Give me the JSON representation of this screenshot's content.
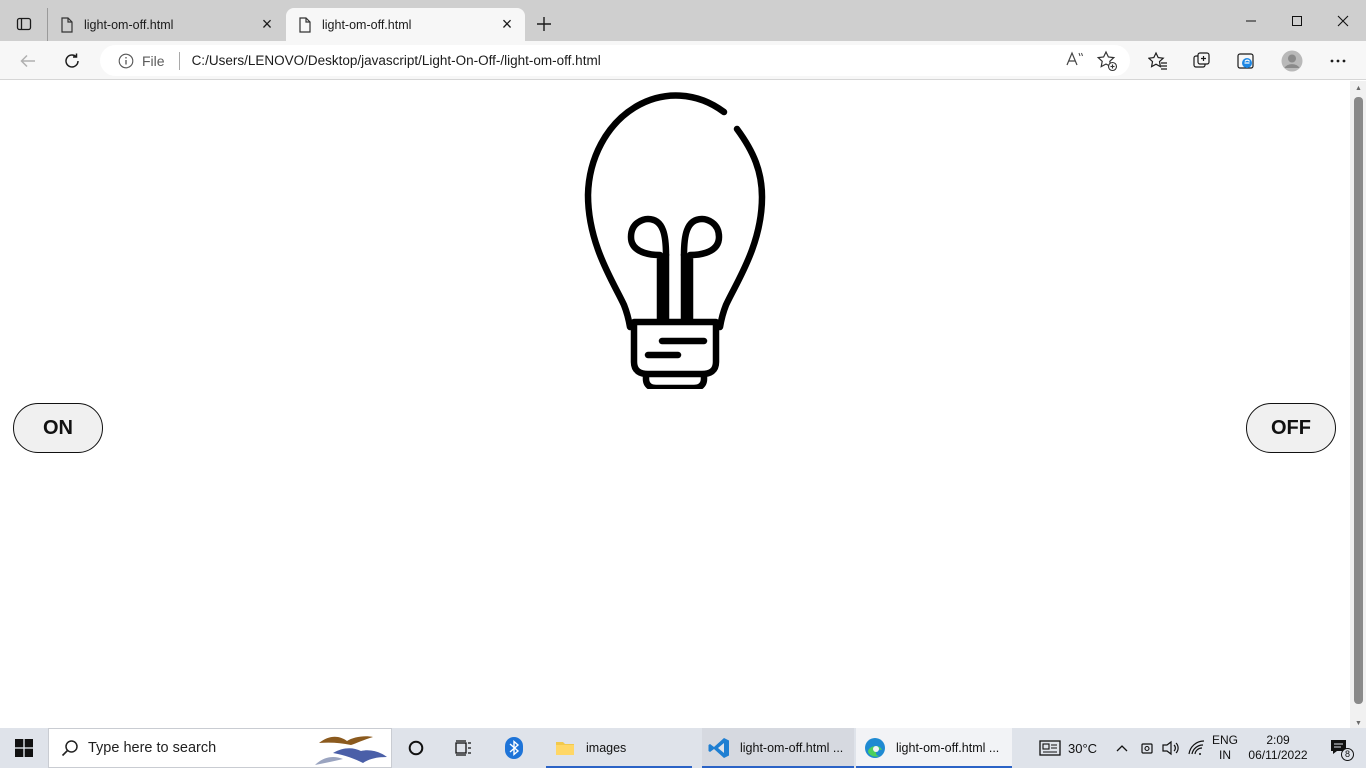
{
  "browser": {
    "tabs": [
      {
        "title": "light-om-off.html",
        "active": false
      },
      {
        "title": "light-om-off.html",
        "active": true
      }
    ],
    "address": {
      "scheme_label": "File",
      "url": "C:/Users/LENOVO/Desktop/javascript/Light-On-Off-/light-om-off.html"
    },
    "read_aloud_label": "A’"
  },
  "page": {
    "bulb_state": "off",
    "on_button": "ON",
    "off_button": "OFF"
  },
  "taskbar": {
    "search_placeholder": "Type here to search",
    "apps": [
      {
        "label": "images",
        "icon": "folder-icon"
      },
      {
        "label": "light-om-off.html ...",
        "icon": "vscode-icon"
      },
      {
        "label": "light-om-off.html ...",
        "icon": "edge-icon"
      }
    ],
    "weather": "30°C",
    "language": "ENG",
    "region": "IN",
    "time": "2:09",
    "date": "06/11/2022",
    "notification_count": "8"
  }
}
